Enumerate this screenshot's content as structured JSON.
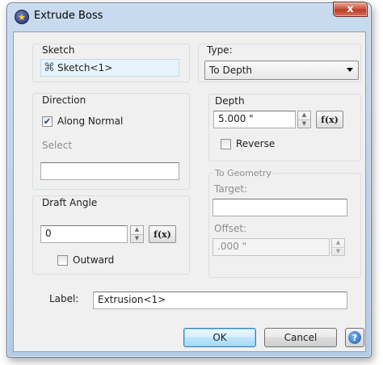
{
  "window": {
    "title": "Extrude Boss",
    "close_glyph": "x",
    "icon": "solidworks-star-icon"
  },
  "sketch": {
    "group_label": "Sketch",
    "value": "Sketch<1>",
    "icon": "sketch-icon"
  },
  "type": {
    "group_label": "Type:",
    "selected": "To Depth"
  },
  "direction": {
    "group_label": "Direction",
    "along_normal_label": "Along Normal",
    "along_normal_checked": true,
    "select_label": "Select",
    "select_value": ""
  },
  "depth": {
    "group_label": "Depth",
    "value": "5.000 \"",
    "reverse_label": "Reverse",
    "reverse_checked": false,
    "fx_label": "f(x)"
  },
  "draft_angle": {
    "group_label": "Draft Angle",
    "value": "0",
    "outward_label": "Outward",
    "outward_checked": false,
    "fx_label": "f(x)"
  },
  "to_geometry": {
    "group_label": "To Geometry",
    "target_label": "Target:",
    "target_value": "",
    "offset_label": "Offset:",
    "offset_value": ".000 \""
  },
  "label": {
    "caption": "Label:",
    "value": "Extrusion<1>"
  },
  "buttons": {
    "ok": "OK",
    "cancel": "Cancel",
    "help_glyph": "?"
  },
  "colors": {
    "title_bar": "#c9dbef",
    "client_bg": "#f0f0f0",
    "sketch_highlight": "#e8f4fb",
    "check_mark": "#24408b"
  }
}
